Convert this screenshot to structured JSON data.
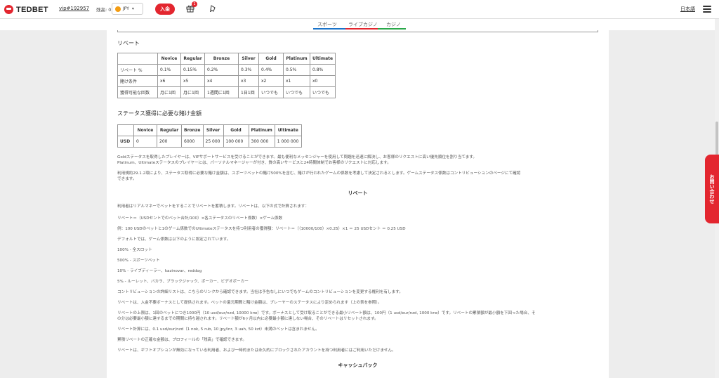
{
  "header": {
    "brand": "TEDBET",
    "user_id": "vip#192957",
    "balance_label": "残高: 0",
    "currency": "JPY",
    "deposit_label": "入金",
    "gift_badge": "1",
    "language": "日本語"
  },
  "nav": {
    "tabs": [
      {
        "label": "スポーツ",
        "color": "#1a73c9"
      },
      {
        "label": "ライブカジノ",
        "color": "#e3262f"
      },
      {
        "label": "カジノ",
        "color": "#2aa84a"
      }
    ]
  },
  "rebate_section": {
    "title": "リベート",
    "headers": [
      "",
      "Novice",
      "Regular",
      "Bronze",
      "Silver",
      "Gold",
      "Platinum",
      "Ultimate"
    ],
    "rows": [
      [
        "リベート %",
        "0.1%",
        "0.15%",
        "0.2%",
        "0.3%",
        "0.4%",
        "0.5%",
        "0.8%"
      ],
      [
        "賭け条件",
        "x6",
        "x5",
        "x4",
        "x3",
        "x2",
        "x1",
        "x0"
      ],
      [
        "獲得可能な回数",
        "月に1回",
        "月に1回",
        "1週間に1回",
        "1日1回",
        "いつでも",
        "いつでも",
        "いつでも"
      ]
    ]
  },
  "status_section": {
    "title": "ステータス獲得に必要な賭け金額",
    "headers": [
      "",
      "Novice",
      "Regular",
      "Bronze",
      "Silver",
      "Gold",
      "Platinum",
      "Ultimate"
    ],
    "rows": [
      [
        "USD",
        "0",
        "200",
        "6000",
        "25 000",
        "100 000",
        "300 000",
        "1 000 000"
      ]
    ]
  },
  "notes": {
    "gold_note_1": "Goldステータスを取得したプレイヤーは、VIPサポートサービスを受けることができます。最も便利なメッセンジャーを使用して問題を迅速に解決し、お客様のリクエストに高い優先順位を割り当てます。",
    "gold_note_2": "Platinum、Ultimateステータスのプレイヤーには、パーソナルマネージャーが付き、質の高いサービスと24時間体制でお客様のリクエストに対応します。",
    "terms_note_1": "利用規約29.1.2項により、ステータス取得に必要な賭け金額は、スポーツベットの賭け500%を含む、賭けが行われたゲームの係数を考慮して決定されるとします。ゲームステータス係数はコントリビューションのページにて確認",
    "terms_note_2": "できます。"
  },
  "rebate_details": {
    "title": "リベート",
    "lines": [
      "利用者はリアルマネーでベットをすることでリベートを蓄積します。リベートは、以下の式で計算されます：",
      "リベート＝（USDセントでのベット合計/100）×各ステータスのリベート係数）×ゲーム係数",
      "例：100 USDのベットと1のゲーム係数でのUltimateステータスを持つ利用者の獲得額：リベート＝（（10000/100）×0.25）×1 ＝ 25 USDセント ＝ 0.25 USD",
      "デフォルトでは、ゲーム係数は以下のように設定されています。",
      "100% - 全スロット",
      "500% - スポーツベット",
      "10% - ライブディーラー、kazinovar、reddog",
      "5% - ルーレット、バカラ、ブラックジャック、ポーカー、ビデオポーカー",
      "コントリビューションの詳細リストは、こちらのリンクから確認できます。当社は予告なしにいつでもゲームのコントリビューションを変更する権利を有します。",
      "リベートは、入金不要ボーナスとして提供されます。ベットの還元期間と賭け金額は、プレーヤーのステータスにより定められます（上の表を参照）。",
      "リベートの上限は、1回のベットにつき1000円（10 usd/eur/nzd, 10000 krw）です。ボーナスとして受け取ることができる最小リベート額は、100円（1 usd/eur/nzd, 1000 krw）です。リベートの累積額が最小額を下回った場合、そ",
      "の分は必要最小額に達するまでの期間に持ち越されます。リベート額が6ヶ月以内に必要最小額に達しない場合、そのリベートはリセットされます。",
      "リベート計算には、0.1 usd/eur/nzd（1 nok, 5 rub, 10 jpy/inr, 3 uah, 50 kzt）未満のベットは含まれません。",
      "累積リベートの正確な金額は、プロフィールの「残高」で確認できます。",
      "リベートは、ギフトオプションが無効になっている利用者、および一時的または永久的にブロックされたアカウントを持つ利用者にはご利用いただけません。"
    ]
  },
  "cashback": {
    "title": "キャッシュバック"
  },
  "contact_tab": {
    "label": "お問い合わせ"
  }
}
